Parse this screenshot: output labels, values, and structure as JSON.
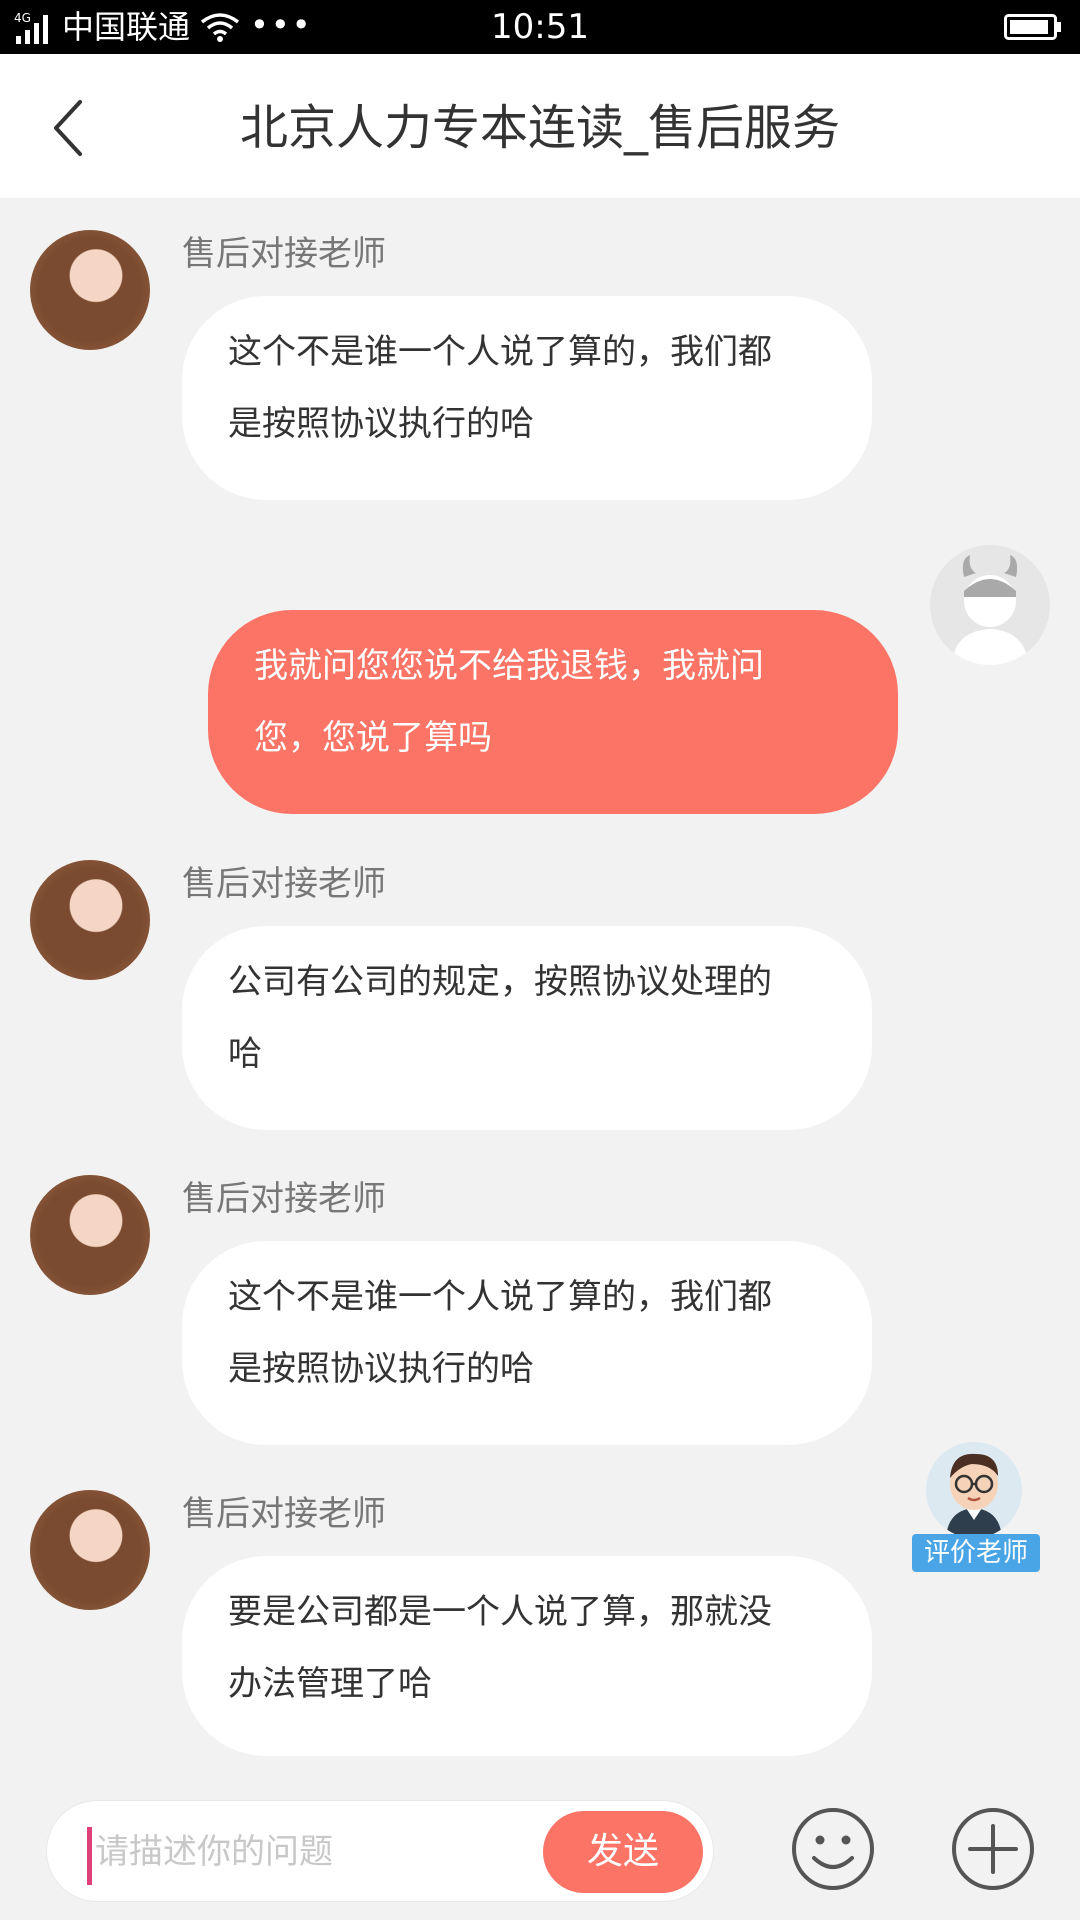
{
  "status_bar": {
    "network": "4G",
    "carrier": "中国联通",
    "dots": "•••",
    "time": "10:51"
  },
  "header": {
    "title": "北京人力专本连读_售后服务"
  },
  "messages": [
    {
      "from": "teacher",
      "sender": "售后对接老师",
      "line1": "这个不是谁一个人说了算的，我们都",
      "line2": "是按照协议执行的哈"
    },
    {
      "from": "me",
      "line1": "我就问您您说不给我退钱，我就问",
      "line2": "您，您说了算吗"
    },
    {
      "from": "teacher",
      "sender": "售后对接老师",
      "line1": "公司有公司的规定，按照协议处理的",
      "line2": "哈"
    },
    {
      "from": "teacher",
      "sender": "售后对接老师",
      "line1": "这个不是谁一个人说了算的，我们都",
      "line2": "是按照协议执行的哈"
    },
    {
      "from": "teacher",
      "sender": "售后对接老师",
      "line1": "要是公司都是一个人说了算，那就没",
      "line2": "办法管理了哈"
    }
  ],
  "rate_teacher": {
    "label": "评价老师"
  },
  "input_bar": {
    "placeholder": "请描述你的问题",
    "send_label": "发送"
  },
  "colors": {
    "accent": "#fb7466",
    "rate_badge": "#49a5e6",
    "cursor": "#e0417a"
  },
  "icons": [
    "back-arrow-icon",
    "signal-icon",
    "wifi-icon",
    "battery-icon",
    "emoji-icon",
    "plus-icon"
  ]
}
